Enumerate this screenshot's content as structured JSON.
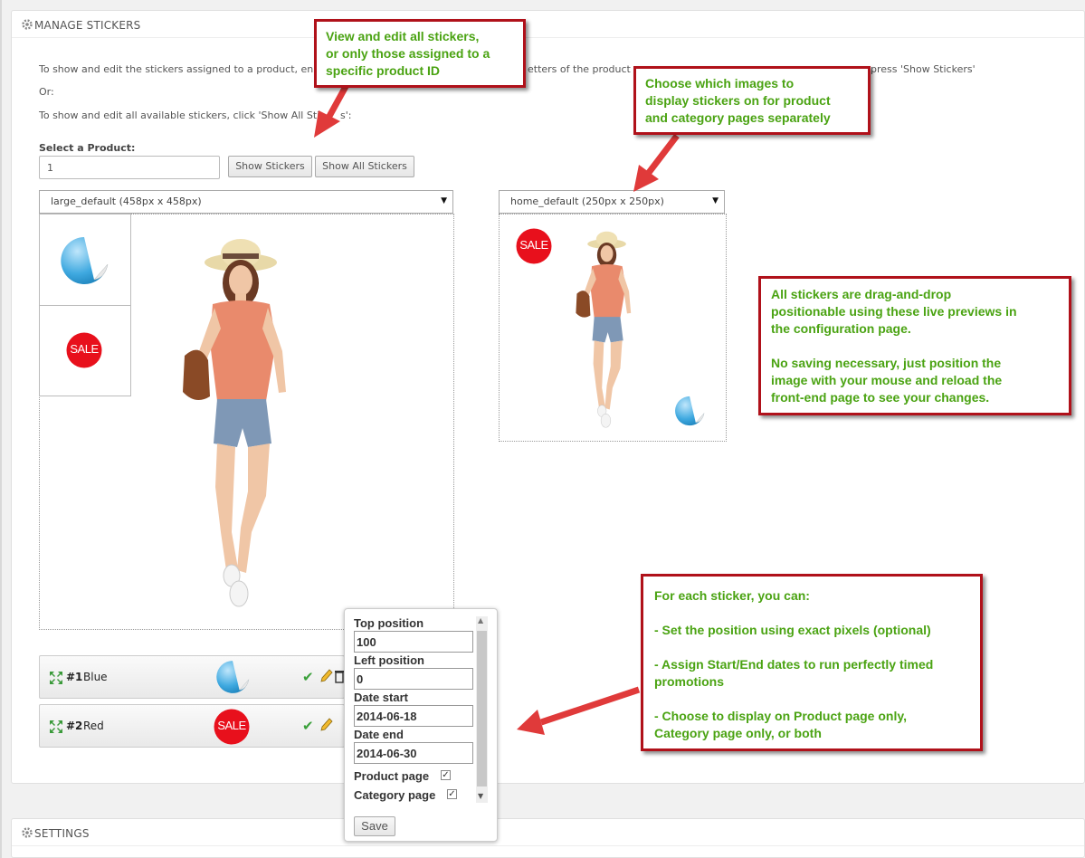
{
  "manage_panel": {
    "title": "MANAGE STICKERS",
    "intro_line1": "To show and edit the stickers assigned to a product, en",
    "intro_line1_tail": "etters of the product n",
    "intro_line1_end": "press 'Show Stickers'",
    "or_text": "Or:",
    "intro_line3": "To show and edit all available stickers, click 'Show All Sti",
    "intro_line3_tail": "s':",
    "select_product_label": "Select a Product:",
    "product_input_value": "1",
    "show_stickers_button": "Show Stickers",
    "show_all_button": "Show All Stickers",
    "large_select": "large_default (458px x 458px)",
    "home_select": "home_default (250px x 250px)",
    "sale_text": "SALE",
    "stickers": [
      {
        "number": "#1",
        "name": "Blue",
        "color": "#3fa9e0"
      },
      {
        "number": "#2",
        "name": "Red",
        "color": "#e8101c"
      }
    ]
  },
  "settings_panel": {
    "title": "SETTINGS"
  },
  "popup": {
    "top_label": "Top position",
    "top_value": "100",
    "left_label": "Left position",
    "left_value": "0",
    "start_label": "Date start",
    "start_value": "2014-06-18",
    "end_label": "Date end",
    "end_value": "2014-06-30",
    "product_page_label": "Product page",
    "category_page_label": "Category page",
    "save_button": "Save"
  },
  "callouts": {
    "c1": [
      "View and edit all stickers,",
      "or only those assigned to a",
      "specific product ID"
    ],
    "c2": [
      "Choose which images to",
      "display stickers on for product",
      "and category pages separately"
    ],
    "c3": [
      "All stickers are drag-and-drop",
      "positionable using these live previews in",
      "the configuration page.",
      "",
      "No saving necessary, just position the",
      "image with your mouse and reload the",
      "front-end page to see your changes."
    ],
    "c4": [
      "For each sticker, you can:",
      "",
      "- Set the position using exact pixels (optional)",
      "",
      "- Assign Start/End dates to run perfectly timed",
      "promotions",
      "",
      "- Choose to display on Product page only,",
      "Category page only, or both"
    ]
  },
  "colors": {
    "accent_red": "#b0111a",
    "callout_text": "#4aa312",
    "sticker_blue": "#3fa9e0",
    "sticker_red": "#e8101c"
  }
}
